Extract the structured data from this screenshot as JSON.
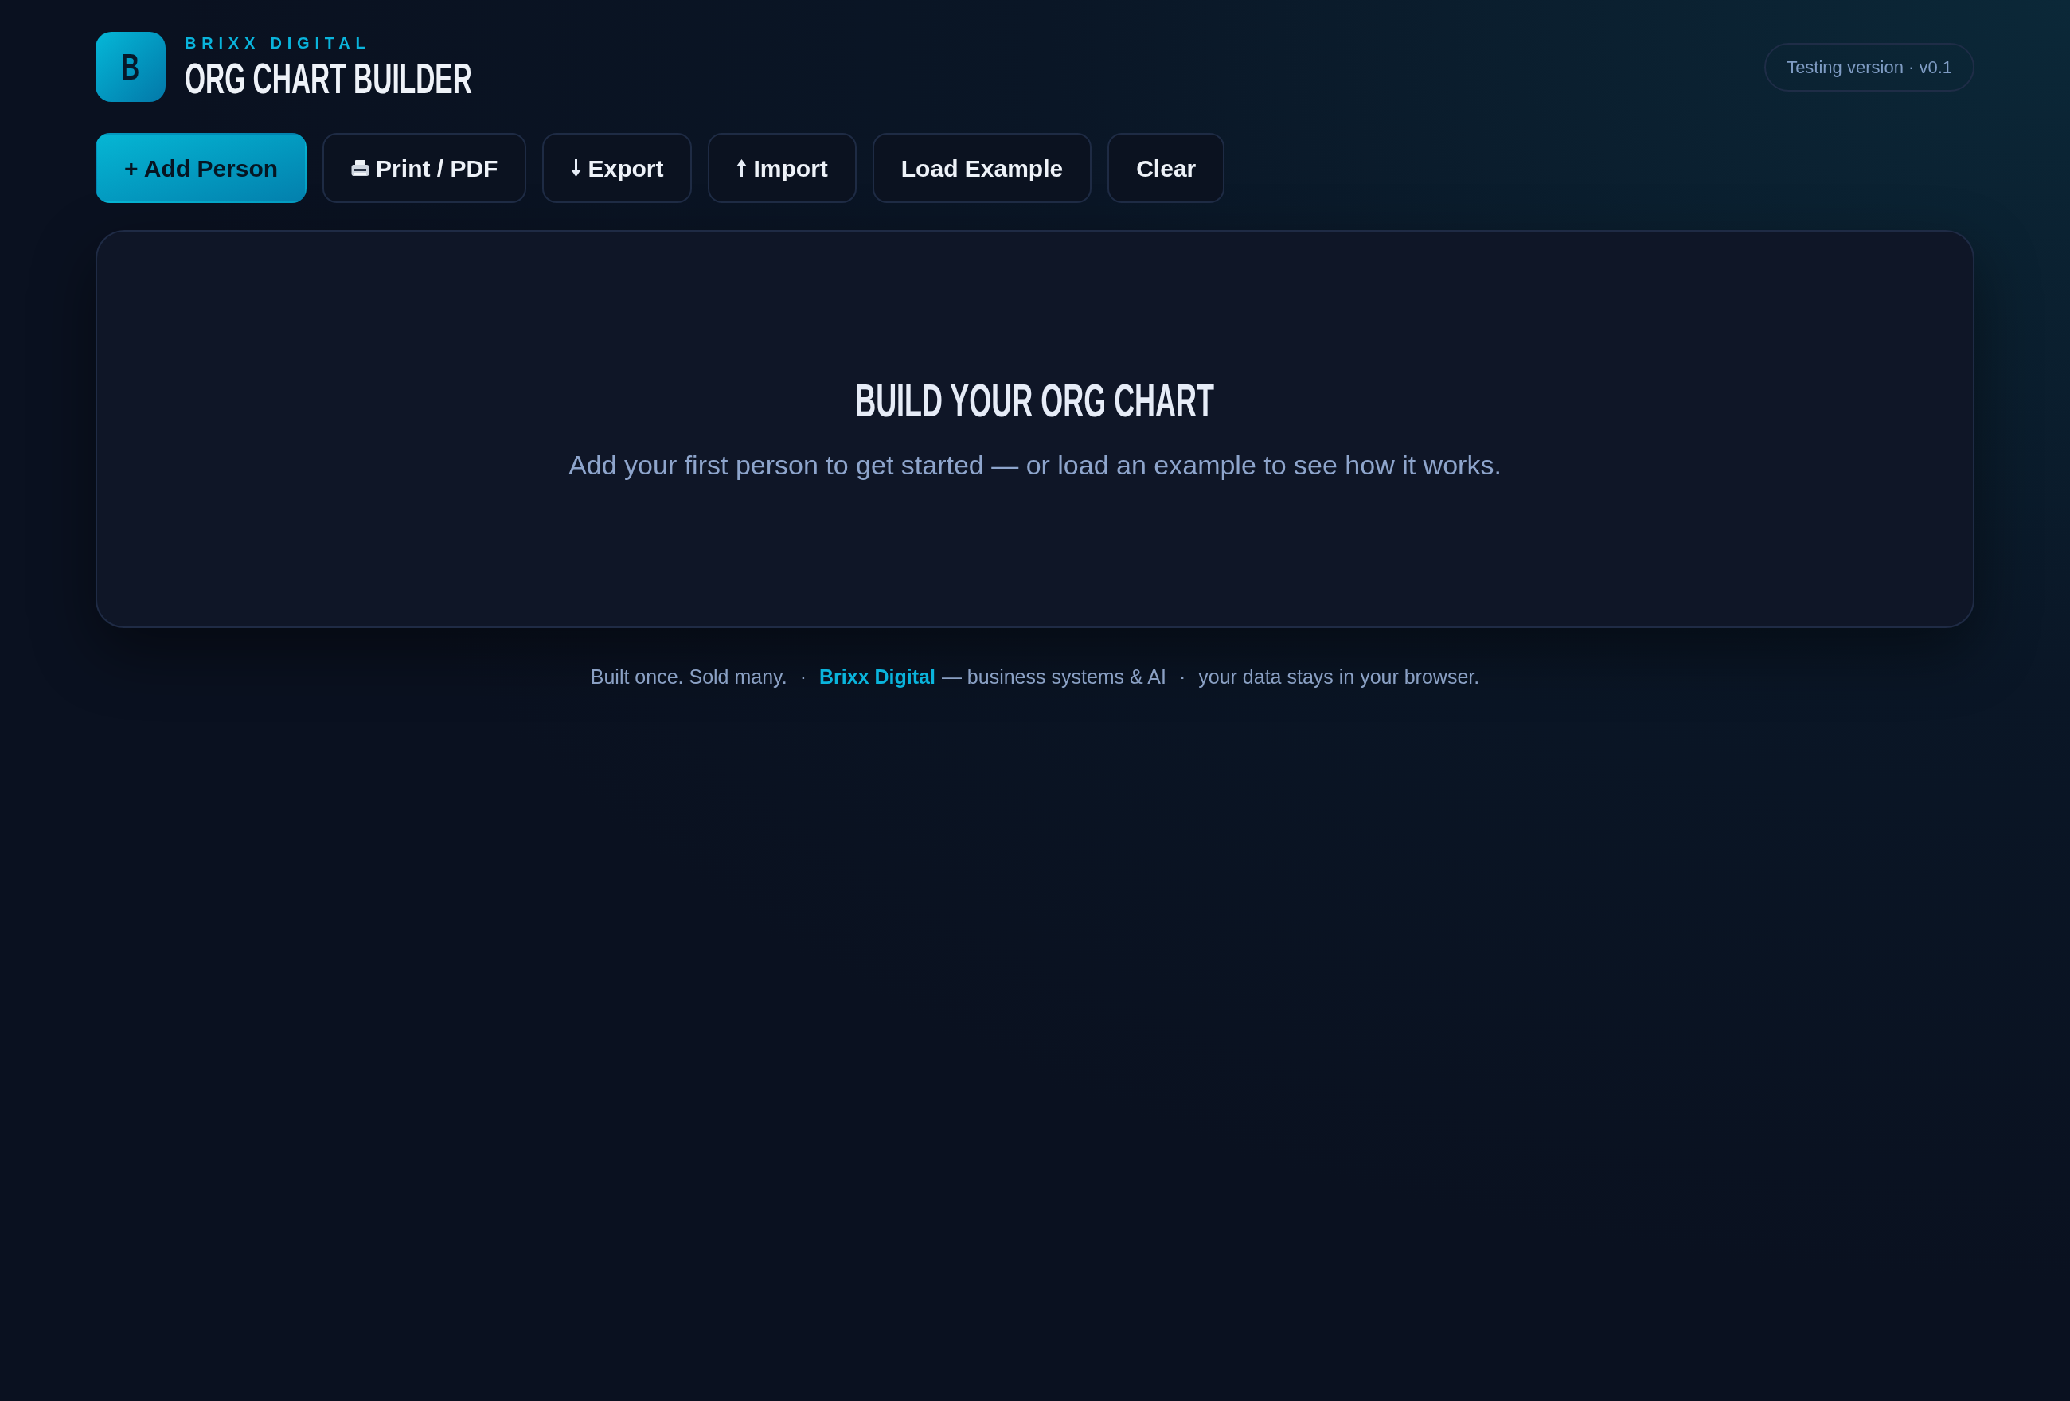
{
  "header": {
    "logo": {
      "letter": "B"
    },
    "brand": "BRIXX DIGITAL",
    "title": "ORG CHART BUILDER",
    "version_badge": "Testing version · v0.1"
  },
  "toolbar": [
    {
      "kind": "primary",
      "label": "+ Add Person"
    },
    {
      "kind": "print",
      "label": "Print / PDF"
    },
    {
      "kind": "export",
      "label": "Export"
    },
    {
      "kind": "import",
      "label": "Import"
    },
    {
      "kind": "plain",
      "label": "Load Example"
    },
    {
      "kind": "plain",
      "label": "Clear"
    }
  ],
  "empty_state": {
    "heading": "BUILD YOUR ORG CHART",
    "message": "Add your first person to get started — or load an example to see how it works."
  },
  "footer": [
    {
      "kind": "text",
      "text": "Built once. Sold many."
    },
    {
      "kind": "separator",
      "text": "·"
    },
    {
      "kind": "link",
      "text": "Brixx Digital"
    },
    {
      "kind": "text",
      "text": "— business systems & AI"
    },
    {
      "kind": "separator",
      "text": "·"
    },
    {
      "kind": "text",
      "text": "your data stays in your browser."
    }
  ]
}
